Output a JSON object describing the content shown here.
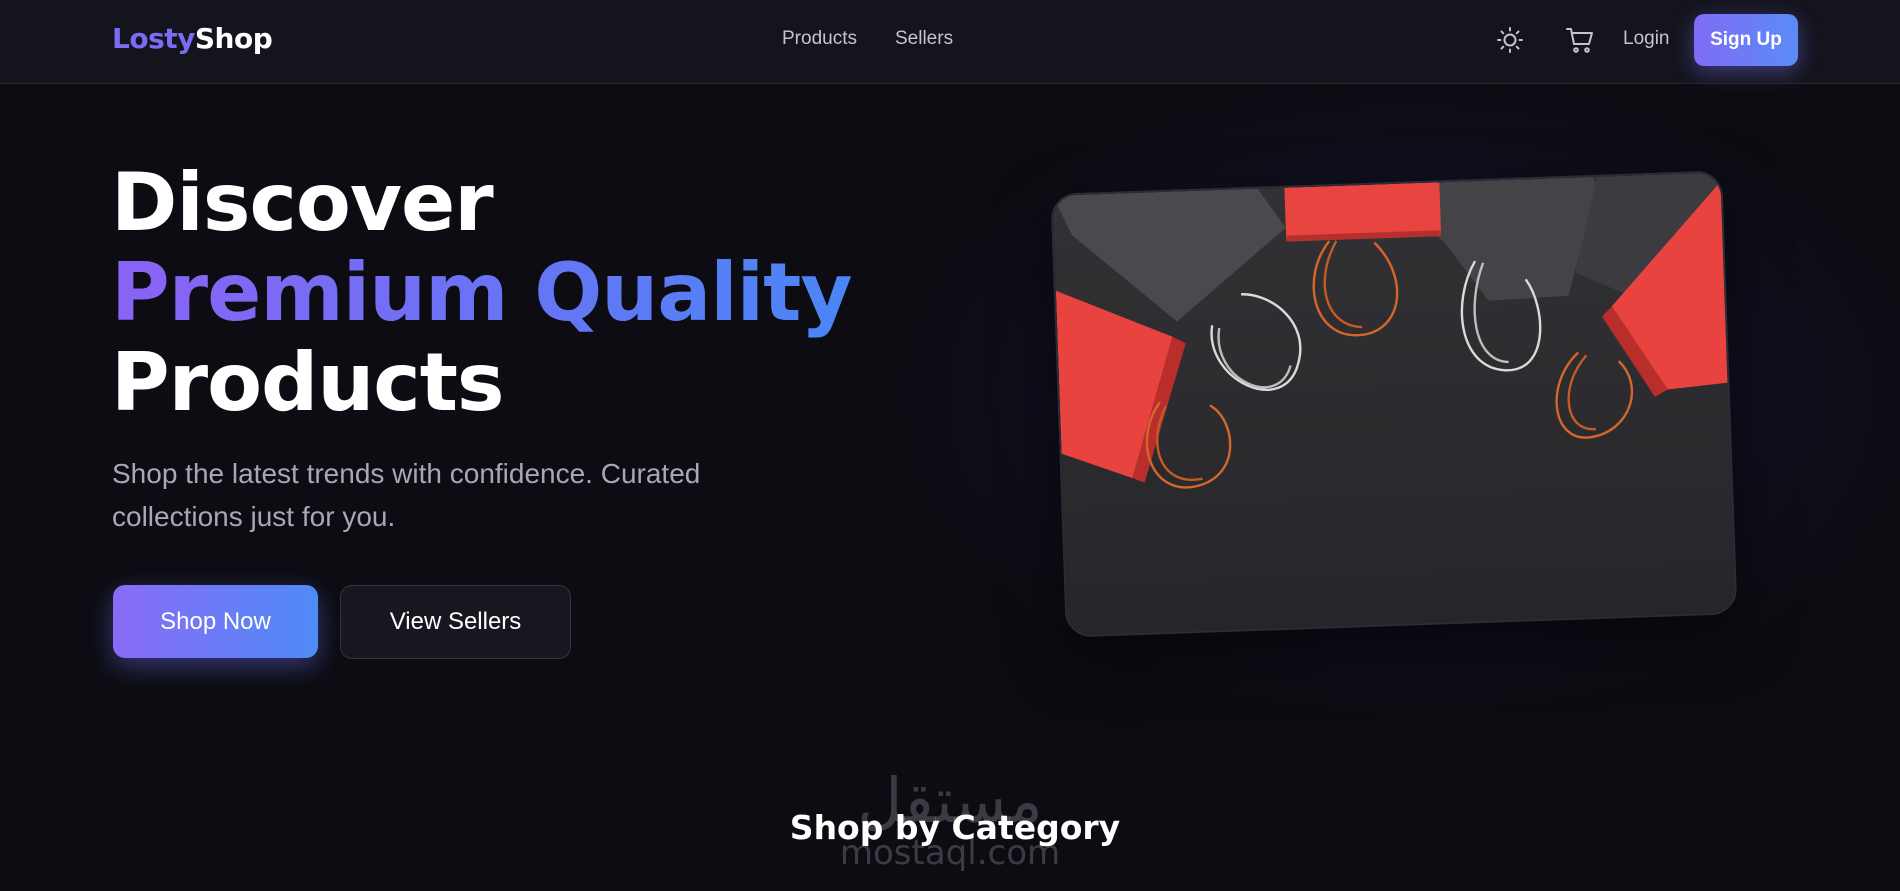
{
  "brand": {
    "part1": "Losty",
    "part2": "Shop"
  },
  "nav": {
    "links": [
      "Products",
      "Sellers"
    ],
    "login_label": "Login",
    "signup_label": "Sign Up",
    "theme_icon": "sun-icon",
    "cart_icon": "cart-icon"
  },
  "hero": {
    "title_line1": "Discover",
    "title_line2": "Premium Quality",
    "title_line3": "Products",
    "subtitle": "Shop the latest trends with confidence. Curated collections just for you.",
    "primary_cta": "Shop Now",
    "secondary_cta": "View Sellers"
  },
  "categories": {
    "title": "Shop by Category"
  },
  "watermark": {
    "arabic": "مستقل",
    "latin": "mostaql.com"
  },
  "colors": {
    "background": "#0c0c12",
    "navbar": "#14141d",
    "accent_purple": "#8a6bf6",
    "accent_blue": "#4f8bf6",
    "bag_red": "#e8433f",
    "bag_gray": "#3a3a3d"
  }
}
